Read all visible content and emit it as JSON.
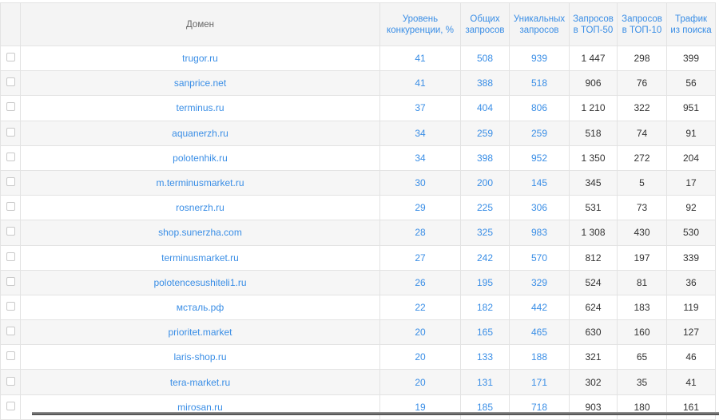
{
  "headers": {
    "domain": "Домен",
    "competition": [
      "Уровень",
      "конкуренции, %"
    ],
    "total": [
      "Общих",
      "запросов"
    ],
    "unique": [
      "Уникальных",
      "запросов"
    ],
    "top50": [
      "Запросов",
      "в ТОП-50"
    ],
    "top10": [
      "Запросов",
      "в ТОП-10"
    ],
    "traffic": [
      "Трафик",
      "из поиска"
    ]
  },
  "rows": [
    {
      "domain": "trugor.ru",
      "competition": "41",
      "total": "508",
      "unique": "939",
      "top50": "1 447",
      "top10": "298",
      "traffic": "399"
    },
    {
      "domain": "sanprice.net",
      "competition": "41",
      "total": "388",
      "unique": "518",
      "top50": "906",
      "top10": "76",
      "traffic": "56"
    },
    {
      "domain": "terminus.ru",
      "competition": "37",
      "total": "404",
      "unique": "806",
      "top50": "1 210",
      "top10": "322",
      "traffic": "951"
    },
    {
      "domain": "aquanerzh.ru",
      "competition": "34",
      "total": "259",
      "unique": "259",
      "top50": "518",
      "top10": "74",
      "traffic": "91"
    },
    {
      "domain": "polotenhik.ru",
      "competition": "34",
      "total": "398",
      "unique": "952",
      "top50": "1 350",
      "top10": "272",
      "traffic": "204"
    },
    {
      "domain": "m.terminusmarket.ru",
      "competition": "30",
      "total": "200",
      "unique": "145",
      "top50": "345",
      "top10": "5",
      "traffic": "17"
    },
    {
      "domain": "rosnerzh.ru",
      "competition": "29",
      "total": "225",
      "unique": "306",
      "top50": "531",
      "top10": "73",
      "traffic": "92"
    },
    {
      "domain": "shop.sunerzha.com",
      "competition": "28",
      "total": "325",
      "unique": "983",
      "top50": "1 308",
      "top10": "430",
      "traffic": "530"
    },
    {
      "domain": "terminusmarket.ru",
      "competition": "27",
      "total": "242",
      "unique": "570",
      "top50": "812",
      "top10": "197",
      "traffic": "339"
    },
    {
      "domain": "polotencesushiteli1.ru",
      "competition": "26",
      "total": "195",
      "unique": "329",
      "top50": "524",
      "top10": "81",
      "traffic": "36"
    },
    {
      "domain": "мсталь.рф",
      "competition": "22",
      "total": "182",
      "unique": "442",
      "top50": "624",
      "top10": "183",
      "traffic": "119"
    },
    {
      "domain": "prioritet.market",
      "competition": "20",
      "total": "165",
      "unique": "465",
      "top50": "630",
      "top10": "160",
      "traffic": "127"
    },
    {
      "domain": "laris-shop.ru",
      "competition": "20",
      "total": "133",
      "unique": "188",
      "top50": "321",
      "top10": "65",
      "traffic": "46"
    },
    {
      "domain": "tera-market.ru",
      "competition": "20",
      "total": "131",
      "unique": "171",
      "top50": "302",
      "top10": "35",
      "traffic": "41"
    },
    {
      "domain": "mirosan.ru",
      "competition": "19",
      "total": "185",
      "unique": "718",
      "top50": "903",
      "top10": "180",
      "traffic": "161"
    }
  ]
}
